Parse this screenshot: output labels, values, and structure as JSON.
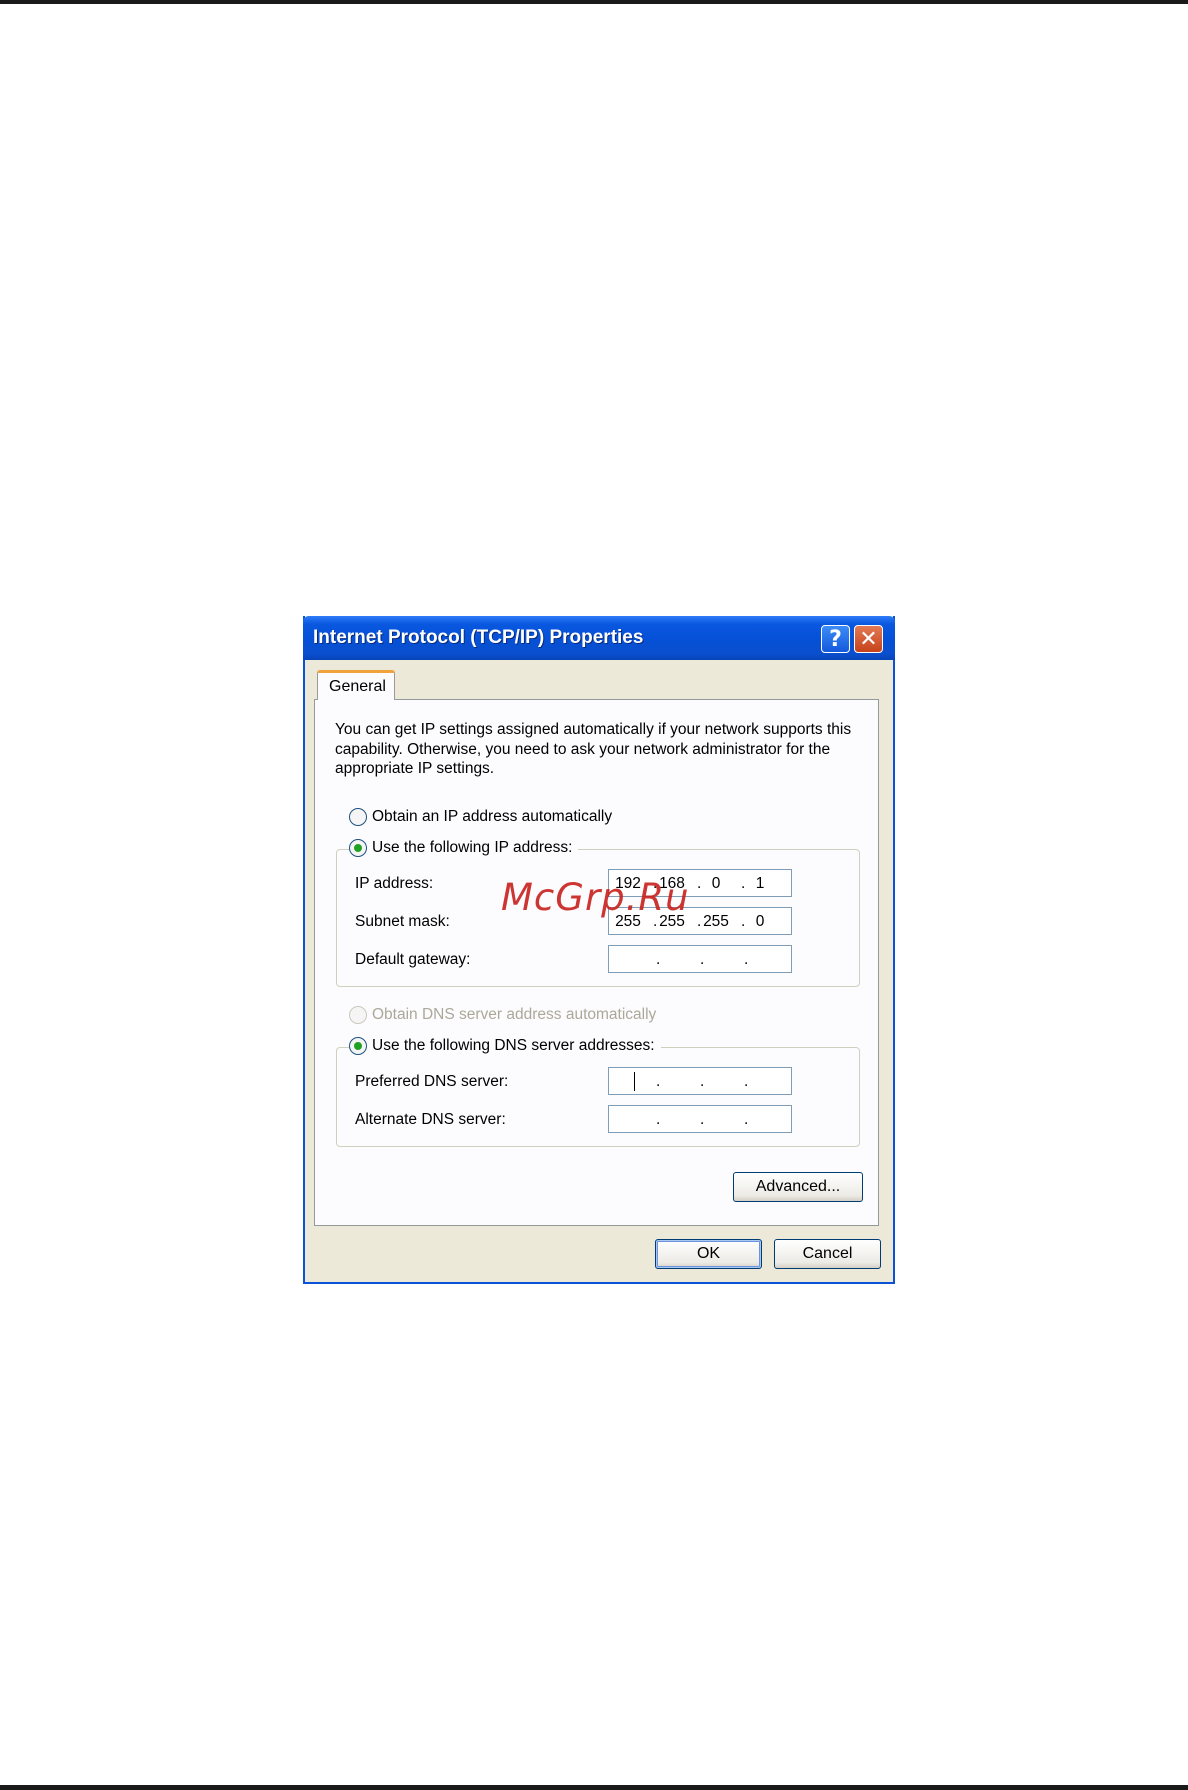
{
  "dialog": {
    "title": "Internet Protocol (TCP/IP) Properties",
    "help_label": "?",
    "close_label": "✕"
  },
  "tabs": [
    {
      "label": "General",
      "selected": true
    }
  ],
  "general": {
    "description": "You can get IP settings assigned automatically if your network supports this capability. Otherwise, you need to ask your network administrator for the appropriate IP settings.",
    "ip_mode": {
      "auto_label": "Obtain an IP address automatically",
      "manual_label": "Use the following IP address:",
      "selected": "manual"
    },
    "ip_fields": {
      "ip_address": {
        "label": "IP address:",
        "octets": [
          "192",
          "168",
          "0",
          "1"
        ]
      },
      "subnet_mask": {
        "label": "Subnet mask:",
        "octets": [
          "255",
          "255",
          "255",
          "0"
        ]
      },
      "default_gateway": {
        "label": "Default gateway:",
        "octets": [
          "",
          "",
          "",
          ""
        ]
      }
    },
    "dns_mode": {
      "auto_label": "Obtain DNS server address automatically",
      "auto_enabled": false,
      "manual_label": "Use the following DNS server addresses:",
      "selected": "manual"
    },
    "dns_fields": {
      "preferred": {
        "label": "Preferred DNS server:",
        "octets": [
          "",
          "",
          "",
          ""
        ]
      },
      "alternate": {
        "label": "Alternate DNS server:",
        "octets": [
          "",
          "",
          "",
          ""
        ]
      }
    },
    "advanced_label": "Advanced..."
  },
  "footer": {
    "ok_label": "OK",
    "cancel_label": "Cancel"
  },
  "watermark": "McGrp.Ru",
  "colors": {
    "titlebar": "#0550d6",
    "dialog_bg": "#ece9d8",
    "radio_check": "#21a121",
    "tab_accent": "#f0a33c",
    "watermark": "#c8201c"
  }
}
